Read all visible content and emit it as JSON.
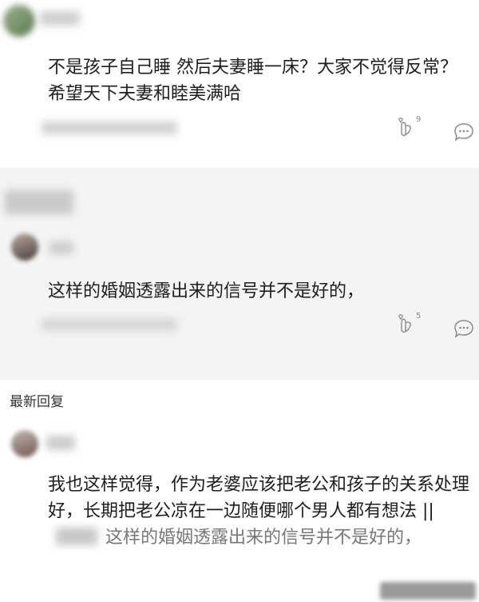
{
  "comment1": {
    "text": "不是孩子自己睡 然后夫妻睡一床？大家不觉得反常？希望天下夫妻和睦美满哈",
    "like_count": "9",
    "like_icon": "hand-heart-icon",
    "reply_icon": "comment-bubble-icon"
  },
  "comment2": {
    "text": "这样的婚姻透露出来的信号并不是好的，",
    "like_count": "5",
    "like_icon": "hand-heart-icon",
    "reply_icon": "comment-bubble-icon"
  },
  "latest_replies": {
    "title": "最新回复",
    "reply": {
      "text": "我也这样觉得，作为老婆应该把老公和孩子的关系处理好，长期把老公凉在一边随便哪个男人都有想法 ||",
      "quoted": "这样的婚姻透露出来的信号并不是好的，"
    }
  },
  "colors": {
    "grey_section": "#f4f4f4",
    "text": "#1e1e1e",
    "icon": "#8a8a8a"
  }
}
